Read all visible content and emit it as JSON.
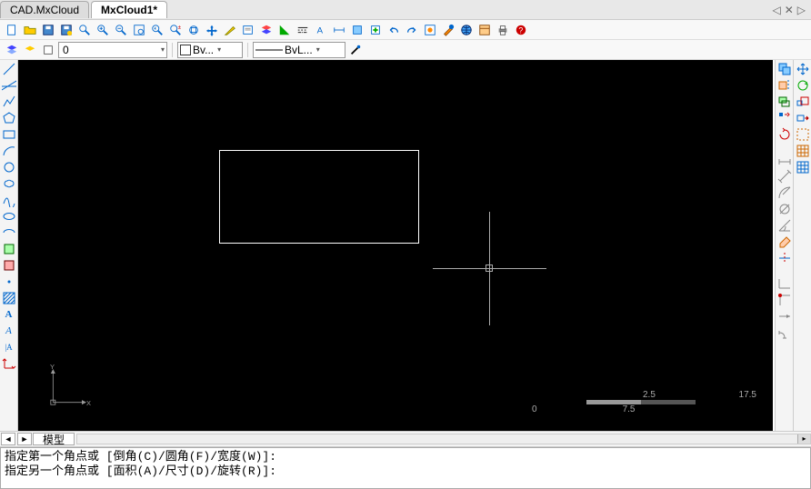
{
  "tabs": {
    "t0": "CAD.MxCloud",
    "t1": "MxCloud1*"
  },
  "tab_nav": {
    "left": "◁",
    "close": "✕",
    "right": "▷"
  },
  "toolbar2": {
    "layer_value": "0",
    "color_label": "Bv...",
    "lineweight_label": "BvL..."
  },
  "bottom": {
    "model_tab": "模型"
  },
  "command": {
    "line1": "指定第一个角点或 [倒角(C)/圆角(F)/宽度(W)]:",
    "line2": "指定另一个角点或 [面积(A)/尺寸(D)/旋转(R)]:"
  },
  "ucs": {
    "x": "X",
    "y": "Y"
  },
  "scale": {
    "v0": "0",
    "v1": "2.5",
    "v2": "7.5",
    "v3": "17.5"
  }
}
